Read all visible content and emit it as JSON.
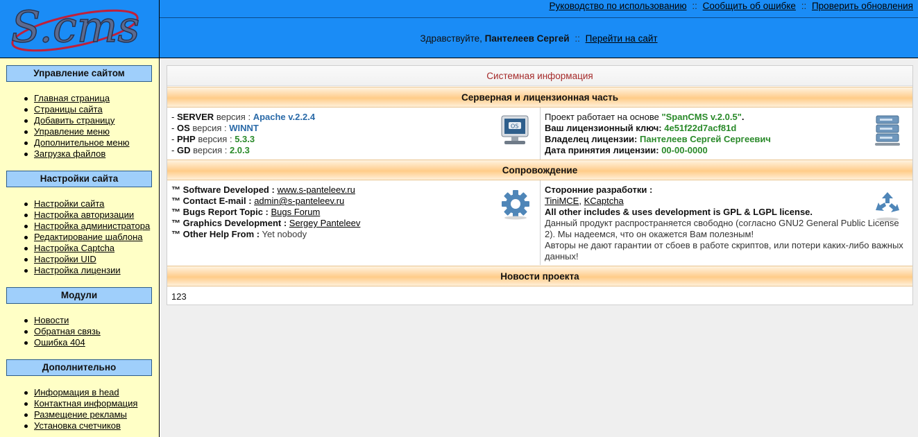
{
  "logo": {
    "text": "S.cms"
  },
  "header": {
    "links": [
      "Руководство по использованию",
      "Сообщить об ошибке",
      "Проверить обновления"
    ],
    "separator": "::",
    "greeting_prefix": "Здравствуйте,",
    "user_name": "Пантелеев Сергей",
    "goto_site": "Перейти на сайт"
  },
  "sidebar": {
    "sections": [
      {
        "title": "Управление сайтом",
        "items": [
          "Главная страница",
          "Страницы сайта",
          "Добавить страницу",
          "Управление меню",
          "Дополнительное меню",
          "Загрузка файлов"
        ]
      },
      {
        "title": "Настройки сайта",
        "items": [
          "Настройки сайта",
          "Настройка авторизации",
          "Настройка администратора",
          "Редактирование шаблона",
          "Настройка Captcha",
          "Настройки UID",
          "Настройка лицензии"
        ]
      },
      {
        "title": "Модули",
        "items": [
          "Новости",
          "Обратная связь",
          "Ошибка 404"
        ]
      },
      {
        "title": "Дополнительно",
        "items": [
          "Информация в head",
          "Контактная информация",
          "Размещение рекламы",
          "Установка счетчиков"
        ]
      }
    ]
  },
  "main": {
    "title": "Системная информация",
    "server_section": {
      "title": "Серверная и лицензионная часть",
      "server": {
        "server_label": "SERVER",
        "server_value": "Apache v.2.2.4",
        "os_label": "OS",
        "os_value": "WINNT",
        "php_label": "PHP",
        "php_value": "5.3.3",
        "gd_label": "GD",
        "gd_value": "2.0.3",
        "version_word": "версия :",
        "dash": "-"
      },
      "license": {
        "project_label": "Проект работает на основе",
        "project_value": "\"SpanCMS v.2.0.5\"",
        "key_label": "Ваш лицензионный ключ:",
        "key_value": "4e51f22d7acf81d",
        "owner_label": "Владелец лицензии:",
        "owner_value": "Пантелеев Сергей Сергеевич",
        "date_label": "Дата принятия лицензии:",
        "date_value": "00-00-0000"
      }
    },
    "support_section": {
      "title": "Сопровождение",
      "left": {
        "dev_label": "™ Software Developed :",
        "dev_value": "www.s-panteleev.ru",
        "email_label": "™ Contact E-mail :",
        "email_value": "admin@s-panteleev.ru",
        "bugs_label": "™ Bugs Report Topic :",
        "bugs_value": "Bugs Forum",
        "gfx_label": "™ Graphics Development :",
        "gfx_value": "Sergey Panteleev",
        "help_label": "™ Other Help From :",
        "help_value": "Yet nobody"
      },
      "right": {
        "third_party_label": "Сторонние разработки :",
        "link1": "TiniMCE",
        "link2": "KCaptcha",
        "comma": ",",
        "gpl": "All other includes & uses development is GPL & LGPL license.",
        "p1": "Данный продукт распространяется свободно (согласно GNU2 General Public License 2). Мы надеемся, что он окажется Вам полезным!",
        "p2": "Авторы не дают гарантии от сбоев в работе скриптов, или потери каких-либо важных данных!"
      }
    },
    "news_section": {
      "title": "Новости проекта",
      "content": "123"
    }
  },
  "colors": {
    "header_blue": "#1a8cf6",
    "sidebar_yellow": "#ffffc6",
    "sidebar_head": "#9fcffb",
    "title_red": "#a52a2a",
    "value_green": "#2a8a2a",
    "value_blue": "#2a6aa8"
  },
  "icons": [
    "os-monitor-icon",
    "server-stack-icon",
    "gear-icon",
    "recycle-icon"
  ]
}
